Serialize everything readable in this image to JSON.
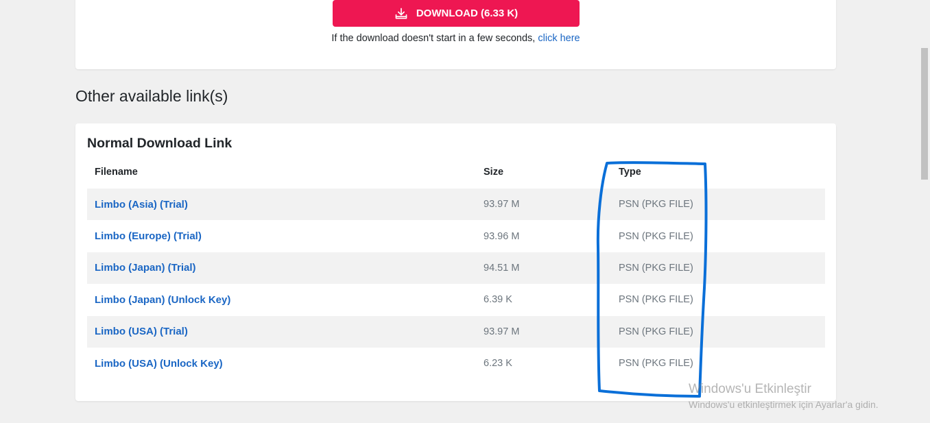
{
  "download": {
    "button_label": "DOWNLOAD (6.33 K)",
    "note_text": "If the download doesn't start in a few seconds, ",
    "click_here": "click here"
  },
  "other_links": {
    "section_title": "Other available link(s)",
    "card_title": "Normal Download Link",
    "headers": {
      "filename": "Filename",
      "size": "Size",
      "type": "Type"
    },
    "rows": [
      {
        "filename": "Limbo (Asia) (Trial)",
        "size": "93.97 M",
        "type": "PSN (PKG FILE)"
      },
      {
        "filename": "Limbo (Europe) (Trial)",
        "size": "93.96 M",
        "type": "PSN (PKG FILE)"
      },
      {
        "filename": "Limbo (Japan) (Trial)",
        "size": "94.51 M",
        "type": "PSN (PKG FILE)"
      },
      {
        "filename": "Limbo (Japan) (Unlock Key)",
        "size": "6.39 K",
        "type": "PSN (PKG FILE)"
      },
      {
        "filename": "Limbo (USA) (Trial)",
        "size": "93.97 M",
        "type": "PSN (PKG FILE)"
      },
      {
        "filename": "Limbo (USA) (Unlock Key)",
        "size": "6.23 K",
        "type": "PSN (PKG FILE)"
      }
    ]
  },
  "watermark": {
    "title": "Windows'u Etkinleştir",
    "subtitle": "Windows'u etkinleştirmek için Ayarlar'a gidin."
  },
  "colors": {
    "button_bg": "#ee1752",
    "link": "#1a66c4",
    "annotation": "#0a6fd8"
  },
  "icons": {
    "download_button": "download-tray-icon"
  }
}
